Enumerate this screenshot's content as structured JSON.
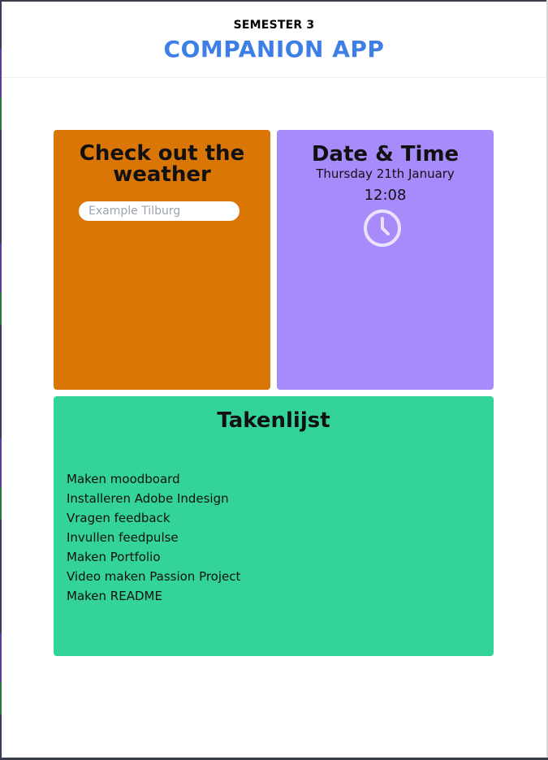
{
  "header": {
    "subtitle": "SEMESTER 3",
    "title": "COMPANION APP"
  },
  "weather": {
    "title": "Check out the weather",
    "input_placeholder": "Example Tilburg",
    "input_value": ""
  },
  "datetime": {
    "title": "Date & Time",
    "date": "Thursday 21th January",
    "time": "12:08",
    "icon": "clock-icon"
  },
  "tasks": {
    "title": "Takenlijst",
    "items": [
      "Maken moodboard",
      "Installeren Adobe Indesign",
      "Vragen feedback",
      "Invullen feedpulse",
      "Maken Portfolio",
      "Video maken Passion Project",
      "Maken README"
    ]
  },
  "colors": {
    "title_blue": "#3e7fe6",
    "weather_card": "#d97606",
    "datetime_card": "#a78bfa",
    "tasks_card": "#34d399"
  }
}
